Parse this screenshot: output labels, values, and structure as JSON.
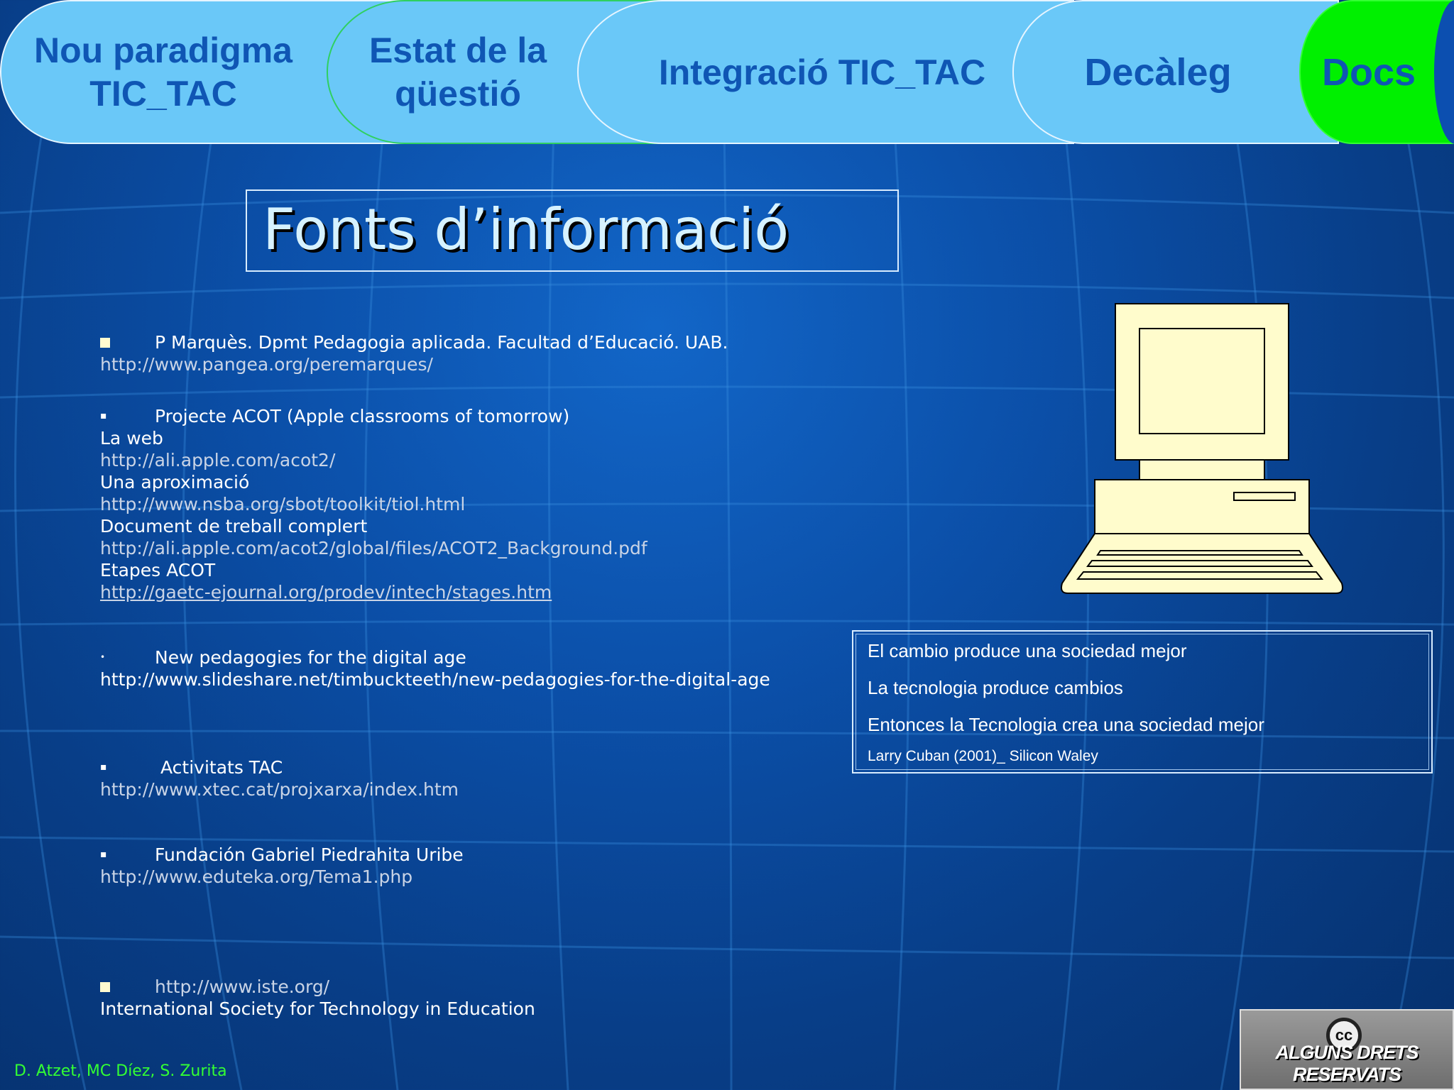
{
  "nav": {
    "tabs": [
      {
        "line1": "Nou paradigma",
        "line2": "TIC_TAC"
      },
      {
        "line1": "Estat de la",
        "line2": "qüestió"
      },
      {
        "label": "Integració TIC_TAC"
      },
      {
        "label": "Decàleg"
      },
      {
        "label": "Docs"
      }
    ]
  },
  "title": "Fonts d’informació",
  "entries": {
    "marques": {
      "head": "P Marquès. Dpmt Pedagogia aplicada. Facultad d’Educació. UAB.",
      "url": "http://www.pangea.org/peremarques/"
    },
    "acot": {
      "head": "Projecte ACOT (Apple classrooms of tomorrow)",
      "lines": [
        "La web",
        "http://ali.apple.com/acot2/",
        "Una aproximació",
        "http://www.nsba.org/sbot/toolkit/tiol.html",
        "Document de treball complert",
        "http://ali.apple.com/acot2/global/files/ACOT2_Background.pdf",
        "Etapes ACOT",
        "http://gaetc-ejournal.org/prodev/intech/stages.htm"
      ]
    },
    "pedagogies": {
      "head": "New pedagogies for the digital age",
      "url": "http://www.slideshare.net/timbuckteeth/new-pedagogies-for-the-digital-age"
    },
    "tac": {
      "head": "Activitats TAC",
      "url": "http://www.xtec.cat/projxarxa/index.htm"
    },
    "fundacion": {
      "head": "Fundación Gabriel Piedrahita Uribe",
      "url": "http://www.eduteka.org/Tema1.php"
    },
    "iste": {
      "head": "http://www.iste.org/",
      "desc": "International Society for Technology in Education"
    }
  },
  "quote": {
    "lines": [
      "El cambio produce una sociedad mejor",
      "La tecnologia produce cambios",
      "Entonces la Tecnologia crea una sociedad mejor"
    ],
    "citation": "Larry Cuban (2001)_ Silicon Waley"
  },
  "footer": {
    "authors": "D. Atzet, MC Díez, S. Zurita",
    "license_text": "ALGUNS DRETS RESERVATS",
    "license_symbol": "cc"
  },
  "colors": {
    "tab_fill": "#6ac8f8",
    "tab_text": "#0f56b4",
    "active_tab": "#00f000",
    "authors_text": "#33ff33"
  },
  "icons": {
    "clipart": "computer-icon",
    "license": "creative-commons-icon"
  }
}
